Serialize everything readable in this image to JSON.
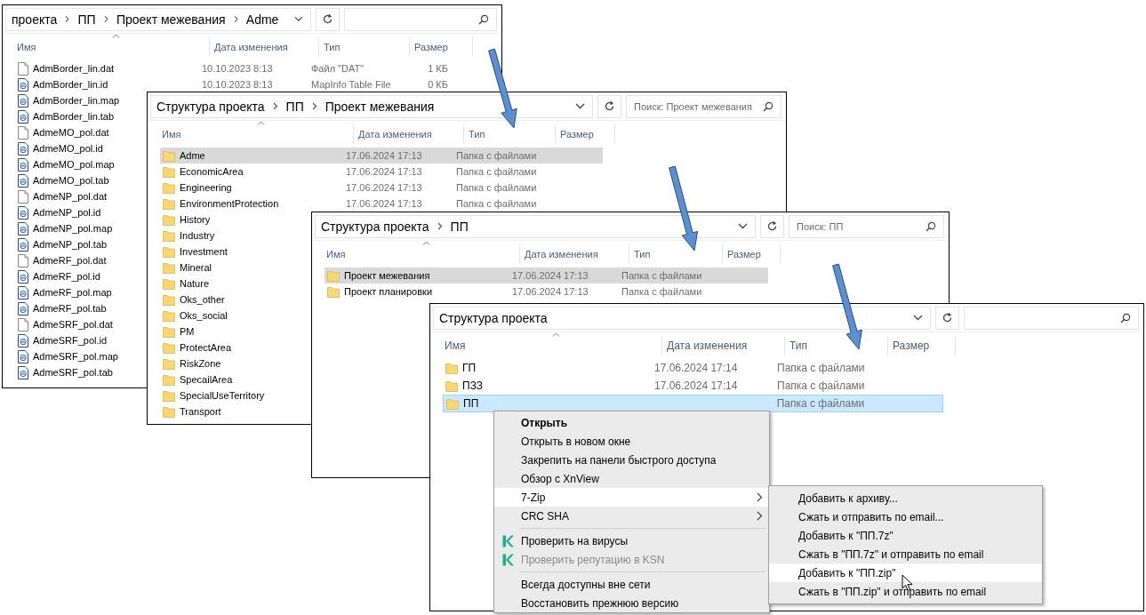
{
  "windows": [
    {
      "breadcrumb": [
        "проекта",
        "ПП",
        "Проект межевания",
        "Adme"
      ],
      "columns": [
        "Имя",
        "Дата изменения",
        "Тип",
        "Размер"
      ],
      "rows": [
        {
          "name": "AdmBorder_lin.dat",
          "kind": "file",
          "date": "10.10.2023 8:13",
          "type": "Файл \"DAT\"",
          "size": "1 КБ",
          "selected": false
        },
        {
          "name": "AdmBorder_lin.id",
          "kind": "mapinfo",
          "date": "10.10.2023 8:13",
          "type": "MapInfo Table File",
          "size": "0 КБ",
          "selected": false
        },
        {
          "name": "AdmBorder_lin.map",
          "kind": "mapinfo",
          "selected": false
        },
        {
          "name": "AdmBorder_lin.tab",
          "kind": "mapinfo",
          "selected": false
        },
        {
          "name": "AdmeMO_pol.dat",
          "kind": "file",
          "selected": false
        },
        {
          "name": "AdmeMO_pol.id",
          "kind": "mapinfo",
          "selected": false
        },
        {
          "name": "AdmeMO_pol.map",
          "kind": "mapinfo",
          "selected": false
        },
        {
          "name": "AdmeMO_pol.tab",
          "kind": "mapinfo",
          "selected": false
        },
        {
          "name": "AdmeNP_pol.dat",
          "kind": "file",
          "selected": false
        },
        {
          "name": "AdmeNP_pol.id",
          "kind": "mapinfo",
          "selected": false
        },
        {
          "name": "AdmeNP_pol.map",
          "kind": "mapinfo",
          "selected": false
        },
        {
          "name": "AdmeNP_pol.tab",
          "kind": "mapinfo",
          "selected": false
        },
        {
          "name": "AdmeRF_pol.dat",
          "kind": "file",
          "selected": false
        },
        {
          "name": "AdmeRF_pol.id",
          "kind": "mapinfo",
          "selected": false
        },
        {
          "name": "AdmeRF_pol.map",
          "kind": "mapinfo",
          "selected": false
        },
        {
          "name": "AdmeRF_pol.tab",
          "kind": "mapinfo",
          "selected": false
        },
        {
          "name": "AdmeSRF_pol.dat",
          "kind": "file",
          "selected": false
        },
        {
          "name": "AdmeSRF_pol.id",
          "kind": "mapinfo",
          "selected": false
        },
        {
          "name": "AdmeSRF_pol.map",
          "kind": "mapinfo",
          "selected": false
        },
        {
          "name": "AdmeSRF_pol.tab",
          "kind": "mapinfo",
          "selected": false
        }
      ]
    },
    {
      "active": false,
      "breadcrumb": [
        "Структура проекта",
        "ПП",
        "Проект межевания"
      ],
      "search": {
        "placeholder": "Поиск: Проект межевания"
      },
      "columns": [
        "Имя",
        "Дата изменения",
        "Тип",
        "Размер"
      ],
      "rows": [
        {
          "name": "Adme",
          "kind": "folder",
          "date": "17.06.2024 17:13",
          "type": "Папка с файлами",
          "selected": true
        },
        {
          "name": "EconomicArea",
          "kind": "folder",
          "date": "17.06.2024 17:13",
          "type": "Папка с файлами",
          "selected": false
        },
        {
          "name": "Engineering",
          "kind": "folder",
          "date": "17.06.2024 17:13",
          "type": "Папка с файлами",
          "selected": false
        },
        {
          "name": "EnvironmentProtection",
          "kind": "folder",
          "date": "17.06.2024 17:13",
          "type": "Папка с файлами",
          "selected": false
        },
        {
          "name": "History",
          "kind": "folder",
          "selected": false
        },
        {
          "name": "Industry",
          "kind": "folder",
          "selected": false
        },
        {
          "name": "Investment",
          "kind": "folder",
          "selected": false
        },
        {
          "name": "Mineral",
          "kind": "folder",
          "selected": false
        },
        {
          "name": "Nature",
          "kind": "folder",
          "selected": false
        },
        {
          "name": "Oks_other",
          "kind": "folder",
          "selected": false
        },
        {
          "name": "Oks_social",
          "kind": "folder",
          "selected": false
        },
        {
          "name": "PM",
          "kind": "folder",
          "selected": false
        },
        {
          "name": "ProtectArea",
          "kind": "folder",
          "selected": false
        },
        {
          "name": "RiskZone",
          "kind": "folder",
          "selected": false
        },
        {
          "name": "SpecailArea",
          "kind": "folder",
          "selected": false
        },
        {
          "name": "SpecialUseTerritory",
          "kind": "folder",
          "selected": false
        },
        {
          "name": "Transport",
          "kind": "folder",
          "selected": false
        }
      ]
    },
    {
      "active": false,
      "breadcrumb": [
        "Структура проекта",
        "ПП"
      ],
      "search": {
        "placeholder": "Поиск: ПП"
      },
      "columns": [
        "Имя",
        "Дата изменения",
        "Тип",
        "Размер"
      ],
      "rows": [
        {
          "name": "Проект межевания",
          "kind": "folder",
          "date": "17.06.2024 17:13",
          "type": "Папка с файлами",
          "selected": true
        },
        {
          "name": "Проект планировки",
          "kind": "folder",
          "date": "17.06.2024 17:13",
          "type": "Папка с файлами",
          "selected": false
        }
      ]
    },
    {
      "active": true,
      "breadcrumb": [
        "Структура проекта"
      ],
      "columns": [
        "Имя",
        "Дата изменения",
        "Тип",
        "Размер"
      ],
      "rows": [
        {
          "name": "ГП",
          "kind": "folder",
          "date": "17.06.2024 17:14",
          "type": "Папка с файлами",
          "selected": false
        },
        {
          "name": "ПЗЗ",
          "kind": "folder",
          "date": "17.06.2024 17:14",
          "type": "Папка с файлами",
          "selected": false
        },
        {
          "name": "ПП",
          "kind": "folder",
          "type": "Папка с файлами",
          "selected": true
        }
      ]
    }
  ],
  "context_menu": {
    "items": [
      {
        "kind": "item",
        "label": "Открыть",
        "default": true,
        "disabled": false,
        "selected": false
      },
      {
        "kind": "item",
        "label": "Открыть в новом окне",
        "default": false,
        "disabled": false,
        "selected": false
      },
      {
        "kind": "item",
        "label": "Закрепить на панели быстрого доступа",
        "default": false,
        "disabled": false,
        "selected": false
      },
      {
        "kind": "item",
        "label": "Обзор с XnView",
        "default": false,
        "disabled": false,
        "selected": false
      },
      {
        "kind": "submenu",
        "label": "7-Zip",
        "default": false,
        "disabled": false,
        "selected": true
      },
      {
        "kind": "submenu",
        "label": "CRC SHA",
        "default": false,
        "disabled": false,
        "selected": false
      },
      {
        "kind": "separator"
      },
      {
        "kind": "antivirus",
        "label": "Проверить на вирусы",
        "default": false,
        "disabled": false,
        "selected": false
      },
      {
        "kind": "antivirus",
        "label": "Проверить репутацию в KSN",
        "default": false,
        "disabled": true,
        "selected": false
      },
      {
        "kind": "separator"
      },
      {
        "kind": "item",
        "label": "Всегда доступны вне сети",
        "default": false,
        "disabled": false,
        "selected": false
      },
      {
        "kind": "item",
        "label": "Восстановить прежнюю версию",
        "default": false,
        "disabled": false,
        "selected": false
      }
    ]
  },
  "submenu": {
    "items": [
      {
        "label": "Добавить к архиву...",
        "selected": false
      },
      {
        "label": "Сжать и отправить по email...",
        "selected": false
      },
      {
        "label": "Добавить к \"ПП.7z\"",
        "selected": false
      },
      {
        "label": "Сжать в \"ПП.7z\" и отправить по email",
        "selected": false
      },
      {
        "label": "Добавить к \"ПП.zip\"",
        "selected": true
      },
      {
        "label": "Сжать в \"ПП.zip\" и отправить по email",
        "selected": false
      }
    ]
  }
}
